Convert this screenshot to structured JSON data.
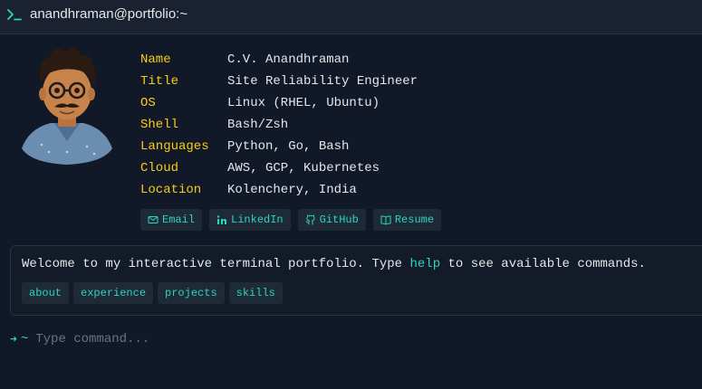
{
  "window": {
    "title": "anandhraman@portfolio:~",
    "icon": "terminal-icon"
  },
  "profile": {
    "avatar_icon": "avatar-illustration",
    "rows": [
      {
        "key": "Name",
        "value": "C.V. Anandhraman"
      },
      {
        "key": "Title",
        "value": "Site Reliability Engineer"
      },
      {
        "key": "OS",
        "value": "Linux (RHEL, Ubuntu)"
      },
      {
        "key": "Shell",
        "value": "Bash/Zsh"
      },
      {
        "key": "Languages",
        "value": "Python, Go, Bash"
      },
      {
        "key": "Cloud",
        "value": "AWS, GCP, Kubernetes"
      },
      {
        "key": "Location",
        "value": "Kolenchery, India"
      }
    ],
    "links": [
      {
        "label": "Email",
        "icon": "mail-icon"
      },
      {
        "label": "LinkedIn",
        "icon": "linkedin-icon"
      },
      {
        "label": "GitHub",
        "icon": "github-icon"
      },
      {
        "label": "Resume",
        "icon": "book-icon"
      }
    ]
  },
  "welcome": {
    "text_before": "Welcome to my interactive terminal portfolio. Type",
    "help_word": "help",
    "text_after": "to see available commands.",
    "chips": [
      "about",
      "experience",
      "projects",
      "skills"
    ]
  },
  "prompt": {
    "arrow": "➜",
    "path": "~",
    "placeholder": "Type command..."
  },
  "colors": {
    "background": "#111827",
    "accent": "#2dd4bf",
    "key": "#facc15"
  }
}
